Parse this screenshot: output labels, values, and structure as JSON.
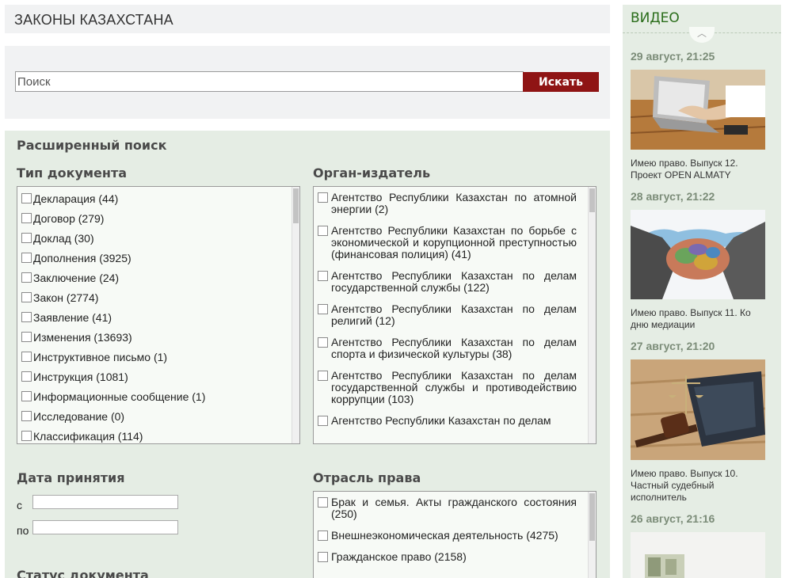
{
  "header": {
    "title": "ЗАКОНЫ КАЗАХСТАНА"
  },
  "search": {
    "placeholder": "Поиск",
    "button": "Искать"
  },
  "advanced": {
    "title": "Расширенный поиск",
    "doc_type": {
      "label": "Тип документа",
      "items": [
        "Декларация (44)",
        "Договор (279)",
        "Доклад (30)",
        "Дополнения (3925)",
        "Заключение (24)",
        "Закон (2774)",
        "Заявление (41)",
        "Изменения (13693)",
        "Инструктивное письмо (1)",
        "Инструкция (1081)",
        "Информационные сообщение (1)",
        "Исследование (0)",
        "Классификация (114)"
      ]
    },
    "issuer": {
      "label": "Орган-издатель",
      "items": [
        "Агентство Республики Казахстан по атомной энергии (2)",
        "Агентство Республики Казахстан по борьбе с экономической и корупционной преступностью (финансовая полиция) (41)",
        "Агентство Республики Казахстан по делам государственной службы (122)",
        "Агентство Республики Казахстан по делам религий (12)",
        "Агентство Республики Казахстан по делам спорта и физической культуры (38)",
        "Агентство Республики Казахстан по делам государственной службы и противодействию коррупции (103)",
        "Агентство Республики Казахстан по делам"
      ]
    },
    "date": {
      "label": "Дата принятия",
      "from": "с",
      "to": "по"
    },
    "branch": {
      "label": "Отрасль права",
      "items": [
        "Брак и семья. Акты гражданского состояния (250)",
        "Внешнеэкономическая деятельность (4275)",
        "Гражданское право (2158)"
      ]
    },
    "status": {
      "label": "Статус документа"
    }
  },
  "sidebar": {
    "title": "ВИДЕО",
    "videos": [
      {
        "date": "29 август, 21:25",
        "caption": "Имею право. Выпуск 12. Проект OPEN ALMATY"
      },
      {
        "date": "28 август, 21:22",
        "caption": "Имею право. Выпуск 11. Ко дню медиации"
      },
      {
        "date": "27 август, 21:20",
        "caption": "Имею право. Выпуск 10. Частный судебный исполнитель"
      },
      {
        "date": "26 август, 21:16",
        "caption": ""
      }
    ]
  },
  "colors": {
    "accent_button": "#8f1414",
    "panel_green": "#e5ede4",
    "sidebar_title": "#2a6d1a"
  }
}
